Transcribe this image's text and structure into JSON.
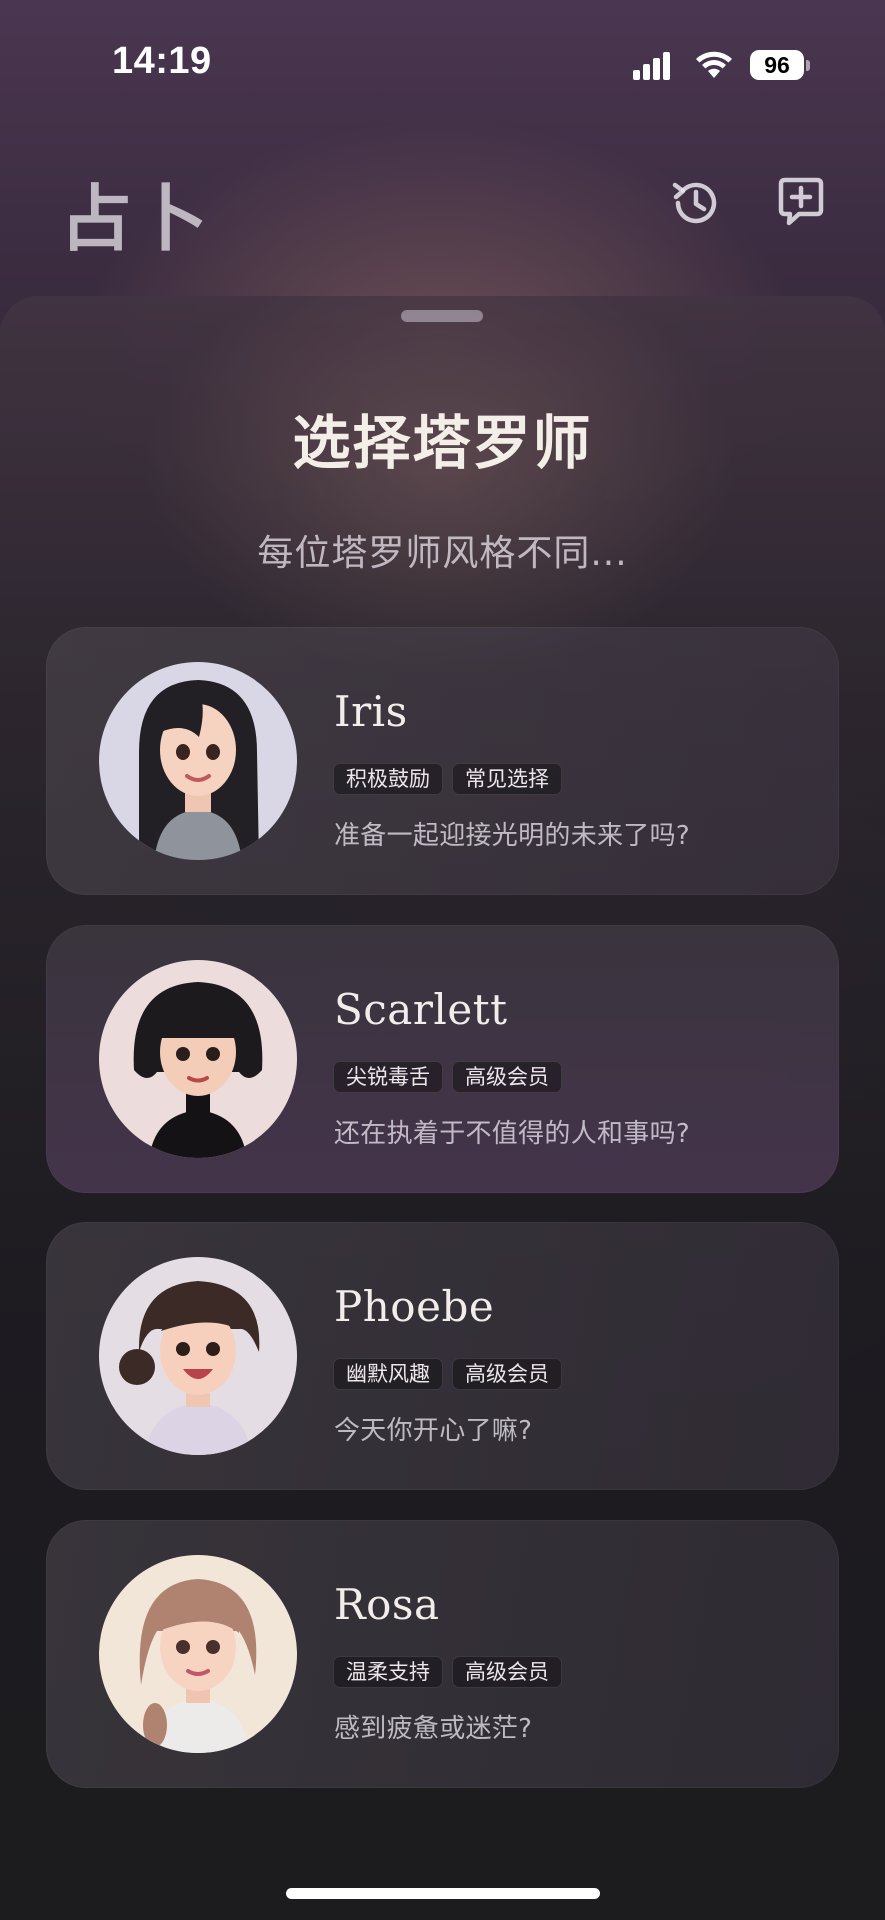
{
  "status_bar": {
    "time": "14:19",
    "battery": "96"
  },
  "header": {
    "title": "占卜",
    "icons": [
      "history-icon",
      "new-chat-icon"
    ]
  },
  "sheet": {
    "title": "选择塔罗师",
    "subtitle": "每位塔罗师风格不同..."
  },
  "readers": [
    {
      "name": "Iris",
      "tags": [
        "积极鼓励",
        "常见选择"
      ],
      "desc": "准备一起迎接光明的未来了吗?",
      "avatar_bg": "#d9d6e6",
      "hair": "#222024",
      "top": "#8e939c"
    },
    {
      "name": "Scarlett",
      "tags": [
        "尖锐毒舌",
        "高级会员"
      ],
      "desc": "还在执着于不值得的人和事吗?",
      "avatar_bg": "#ecdcdc",
      "hair": "#1c1a1c",
      "top": "#141214"
    },
    {
      "name": "Phoebe",
      "tags": [
        "幽默风趣",
        "高级会员"
      ],
      "desc": "今天你开心了嘛?",
      "avatar_bg": "#e4dee4",
      "hair": "#3c2a26",
      "top": "#dcd4e4"
    },
    {
      "name": "Rosa",
      "tags": [
        "温柔支持",
        "高级会员"
      ],
      "desc": "感到疲惫或迷茫?",
      "avatar_bg": "#f2e6d8",
      "hair": "#b08270",
      "top": "#ecebea"
    }
  ],
  "colors": {
    "accent_highlight": "#5c4266",
    "card": "#4e4850",
    "text_primary": "#f2ecea"
  }
}
